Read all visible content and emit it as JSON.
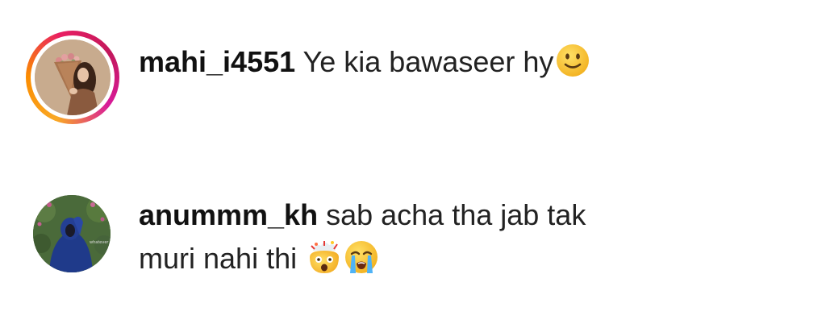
{
  "comments": [
    {
      "username": "mahi_i4551",
      "text": "Ye kia bawaseer hy",
      "emojis": [
        "slightly-smiling-face"
      ],
      "has_story_ring": true
    },
    {
      "username": "anummm_kh",
      "text_line1": "sab acha tha jab tak",
      "text_line2": "muri nahi thi",
      "emojis": [
        "exploding-head",
        "loudly-crying-face"
      ],
      "has_story_ring": false
    }
  ],
  "colors": {
    "background": "#ffffff",
    "text": "#111111",
    "story_ring_start": "#f9a825",
    "story_ring_end": "#d81b9a",
    "emoji_yellow": "#f7c01f"
  }
}
